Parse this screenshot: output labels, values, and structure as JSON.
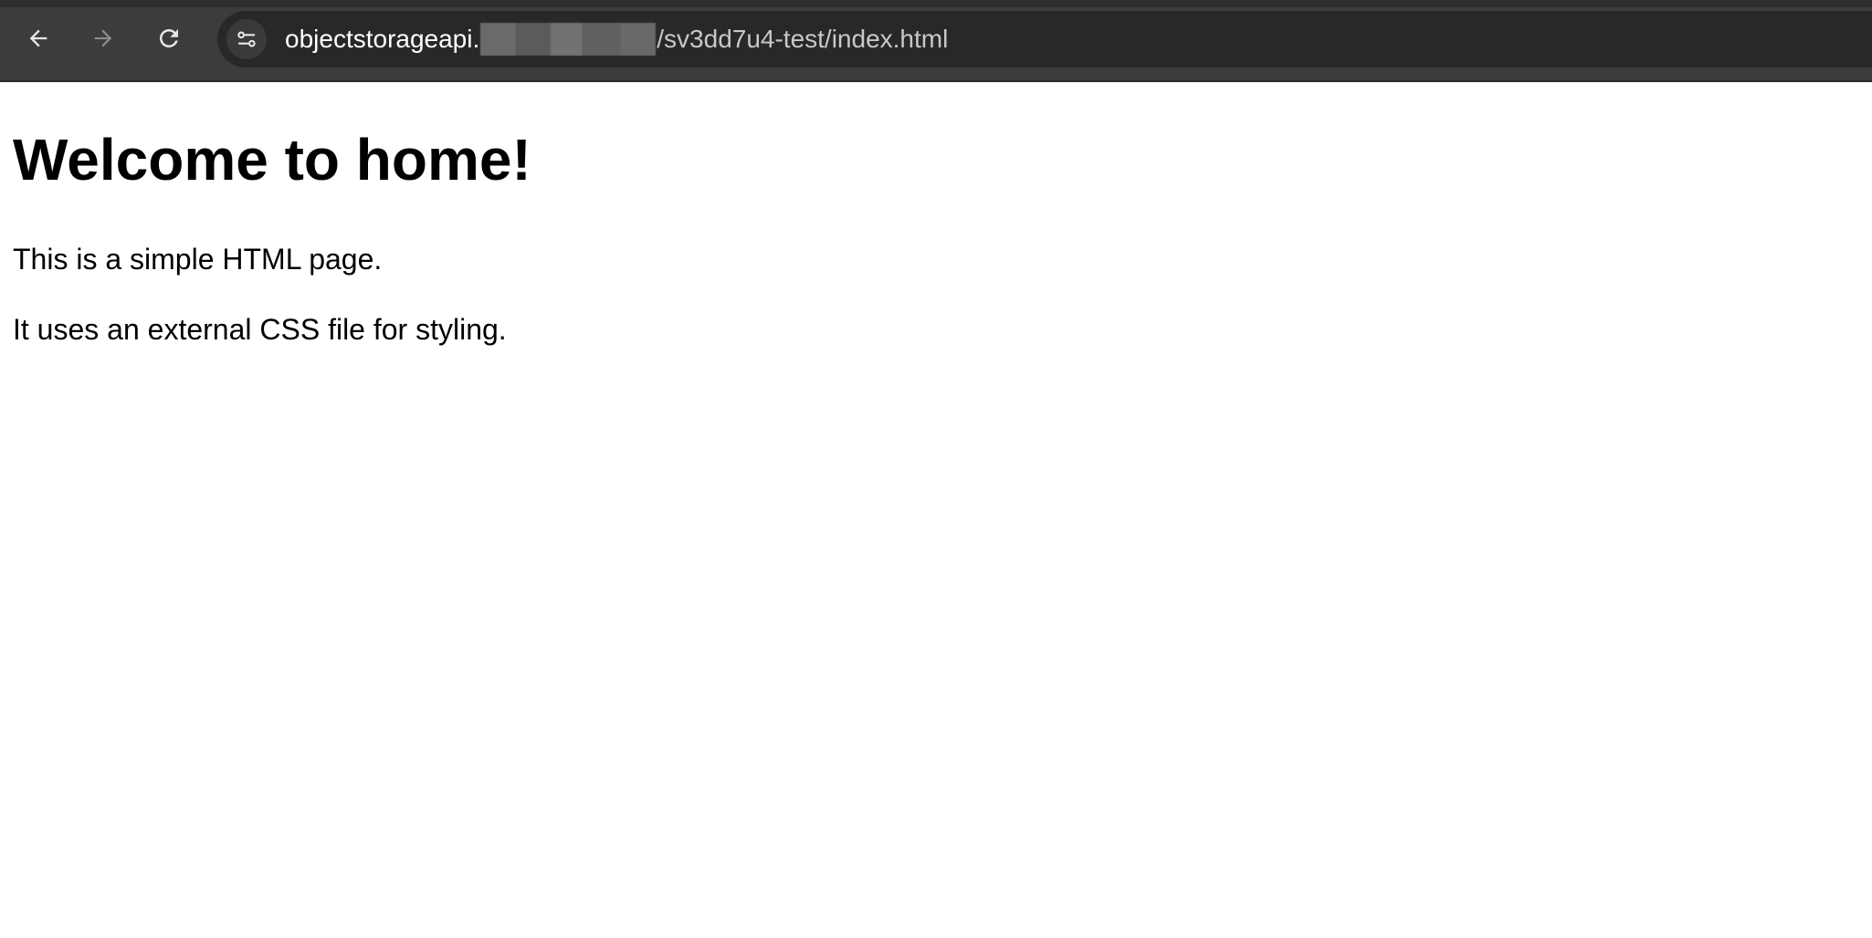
{
  "browser": {
    "url": {
      "host": "objectstorageapi.",
      "path": "/sv3dd7u4-test/index.html"
    },
    "icons": {
      "back": "arrow-left-icon",
      "forward": "arrow-right-icon",
      "reload": "reload-icon",
      "site_info": "tune-icon"
    },
    "colors": {
      "toolbar": "#3c3c3c",
      "omnibox": "#282828",
      "icon": "#e8e8e8",
      "icon_disabled": "#8a8a8a"
    }
  },
  "page": {
    "heading": "Welcome to home!",
    "paragraphs": [
      "This is a simple HTML page.",
      "It uses an external CSS file for styling."
    ]
  }
}
